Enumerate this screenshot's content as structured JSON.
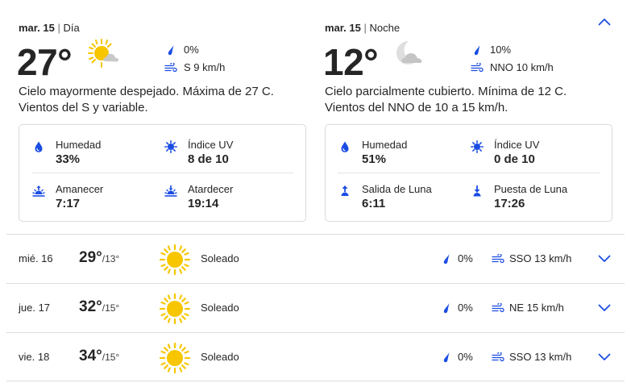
{
  "colors": {
    "accent": "#1b4de4",
    "sun": "#f7c600",
    "cloud": "#c9c9c9"
  },
  "day": {
    "date": "mar. 15",
    "separator": "|",
    "period": "Día",
    "temp": "27°",
    "icon": "sun-cloud-icon",
    "precip": "0%",
    "wind": "S 9 km/h",
    "description": "Cielo mayormente despejado. Máxima de 27 C. Vientos del S y variable.",
    "stats": [
      {
        "label": "Humedad",
        "value": "33%",
        "icon": "humidity-icon"
      },
      {
        "label": "Índice UV",
        "value": "8 de 10",
        "icon": "uv-icon"
      },
      {
        "label": "Amanecer",
        "value": "7:17",
        "icon": "sunrise-icon"
      },
      {
        "label": "Atardecer",
        "value": "19:14",
        "icon": "sunset-icon"
      }
    ]
  },
  "night": {
    "date": "mar. 15",
    "separator": "|",
    "period": "Noche",
    "temp": "12°",
    "icon": "moon-cloud-icon",
    "precip": "10%",
    "wind": "NNO 10 km/h",
    "description": "Cielo parcialmente cubierto. Mínima de 12 C. Vientos del NNO de 10 a 15 km/h.",
    "stats": [
      {
        "label": "Humedad",
        "value": "51%",
        "icon": "humidity-icon"
      },
      {
        "label": "Índice UV",
        "value": "0 de 10",
        "icon": "uv-icon"
      },
      {
        "label": "Salida de Luna",
        "value": "6:11",
        "icon": "moonrise-icon"
      },
      {
        "label": "Puesta de Luna",
        "value": "17:26",
        "icon": "moonset-icon"
      }
    ]
  },
  "forecast": [
    {
      "date": "mié. 16",
      "high": "29°",
      "low": "/13°",
      "condition": "Soleado",
      "precip": "0%",
      "wind": "SSO 13 km/h"
    },
    {
      "date": "jue. 17",
      "high": "32°",
      "low": "/15°",
      "condition": "Soleado",
      "precip": "0%",
      "wind": "NE 15 km/h"
    },
    {
      "date": "vie. 18",
      "high": "34°",
      "low": "/15°",
      "condition": "Soleado",
      "precip": "0%",
      "wind": "SSO 13 km/h"
    }
  ]
}
